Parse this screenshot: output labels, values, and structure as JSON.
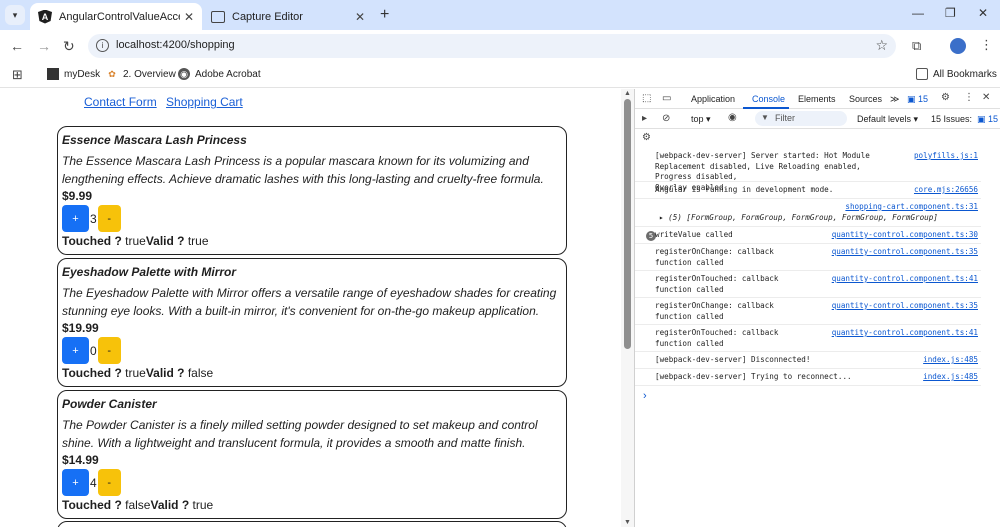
{
  "browser": {
    "tabs": [
      {
        "title": "AngularControlValueAccessor",
        "active": true,
        "icon": "angular-icon"
      },
      {
        "title": "Capture Editor",
        "active": false,
        "icon": "capture-icon"
      }
    ],
    "url": "localhost:4200/shopping",
    "bookmarks": [
      {
        "label": "myDesk",
        "icon": "mydesk-icon"
      },
      {
        "label": "2. Overview",
        "icon": "overview-icon"
      },
      {
        "label": "Adobe Acrobat",
        "icon": "acrobat-icon"
      }
    ],
    "all_bookmarks": "All Bookmarks"
  },
  "page": {
    "nav": {
      "contact": "Contact Form",
      "cart": "Shopping Cart"
    },
    "touched_label": "Touched ?",
    "valid_label": "Valid ?",
    "plus_label": "+",
    "minus_label": "-",
    "products": [
      {
        "name": "Essence Mascara Lash Princess",
        "description": "The Essence Mascara Lash Princess is a popular mascara known for its volumizing and lengthening effects. Achieve dramatic lashes with this long-lasting and cruelty-free formula.",
        "price": "$9.99",
        "quantity": "3",
        "touched": "true",
        "valid": "true"
      },
      {
        "name": "Eyeshadow Palette with Mirror",
        "description": "The Eyeshadow Palette with Mirror offers a versatile range of eyeshadow shades for creating stunning eye looks. With a built-in mirror, it's convenient for on-the-go makeup application.",
        "price": "$19.99",
        "quantity": "0",
        "touched": "true",
        "valid": "false"
      },
      {
        "name": "Powder Canister",
        "description": "The Powder Canister is a finely milled setting powder designed to set makeup and control shine. With a lightweight and translucent formula, it provides a smooth and matte finish.",
        "price": "$14.99",
        "quantity": "4",
        "touched": "false",
        "valid": "true"
      }
    ]
  },
  "devtools": {
    "tabs": [
      "Application",
      "Console",
      "Elements",
      "Sources"
    ],
    "active_tab": "Console",
    "issues_badge": "15",
    "context": "top",
    "filter_placeholder": "Filter",
    "levels": "Default levels",
    "issues_text": "15 Issues:",
    "issues_count": "15",
    "messages": [
      {
        "text": "[webpack-dev-server] Server started: Hot Module\nReplacement disabled, Live Reloading enabled, Progress disabled,\nOverlay enabled.",
        "source": "polyfills.js:1"
      },
      {
        "text": "Angular is running in development mode.",
        "source": "core.mjs:26656"
      },
      {
        "text": "",
        "source": "shopping-cart.component.ts:31"
      },
      {
        "text": "writeValue called",
        "source": "quantity-control.component.ts:30",
        "count": "5"
      },
      {
        "text": "registerOnChange: callback\nfunction called",
        "source": "quantity-control.component.ts:35"
      },
      {
        "text": "registerOnTouched: callback\nfunction called",
        "source": "quantity-control.component.ts:41"
      },
      {
        "text": "registerOnChange: callback\nfunction called",
        "source": "quantity-control.component.ts:35"
      },
      {
        "text": "registerOnTouched: callback\nfunction called",
        "source": "quantity-control.component.ts:41"
      },
      {
        "text": "[webpack-dev-server] Disconnected!",
        "source": "index.js:485"
      },
      {
        "text": "[webpack-dev-server] Trying to reconnect...",
        "source": "index.js:485"
      }
    ],
    "form_group_line": "▸ (5) [FormGroup, FormGroup, FormGroup, FormGroup, FormGroup]",
    "prompt": "›"
  }
}
